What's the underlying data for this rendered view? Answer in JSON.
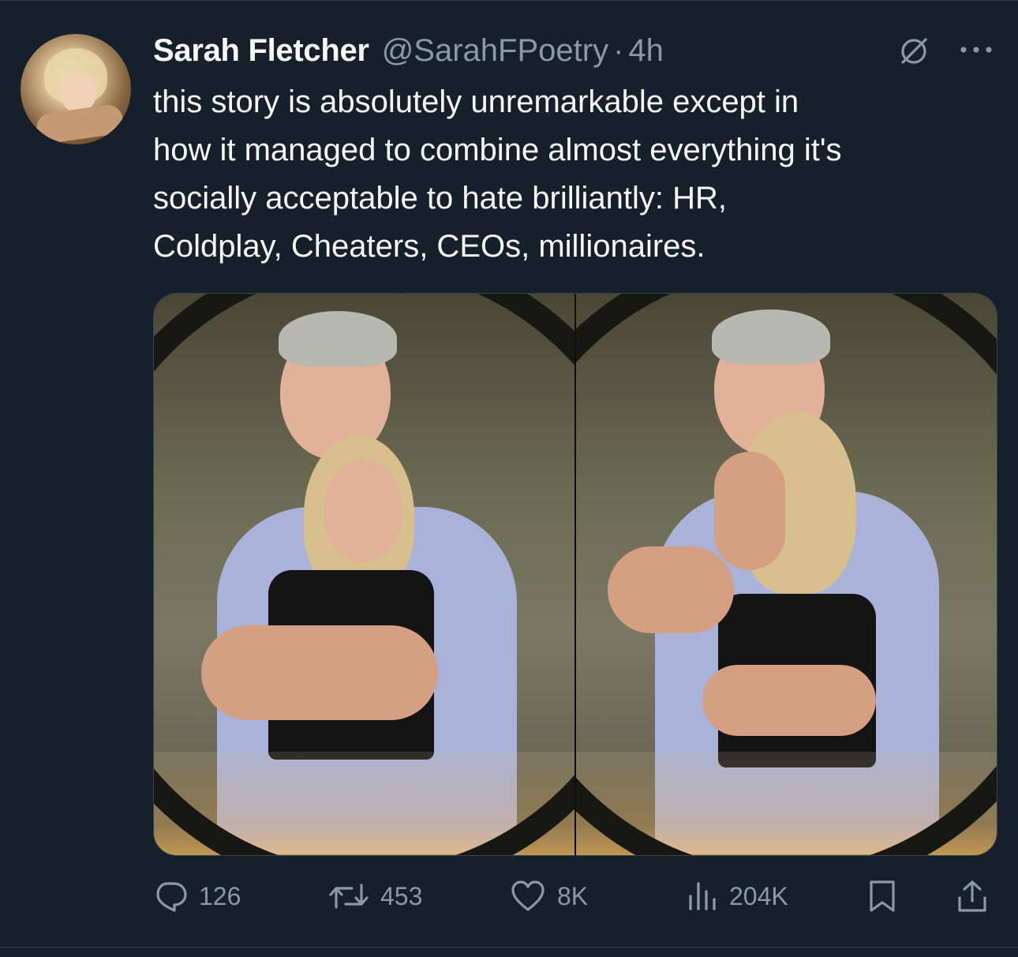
{
  "author": {
    "display_name": "Sarah Fletcher",
    "handle": "@SarahFPoetry",
    "separator": "·",
    "time": "4h"
  },
  "icons": {
    "grok": "grok-icon",
    "more": "more-icon",
    "reply": "reply-icon",
    "retweet": "retweet-icon",
    "like": "heart-icon",
    "views": "views-icon",
    "bookmark": "bookmark-icon",
    "share": "share-icon"
  },
  "tweet": {
    "lines": [
      "this story is absolutely unremarkable except in",
      "how it managed to combine almost everything it's",
      "socially acceptable to hate brilliantly: HR,",
      "Coldplay, Cheaters, CEOs, millionaires."
    ]
  },
  "media": {
    "count": 2
  },
  "metrics": {
    "replies": "126",
    "retweets": "453",
    "likes": "8K",
    "views": "204K"
  },
  "colors": {
    "background": "#15202b",
    "text": "#f7f9f9",
    "secondary": "#8b98a5",
    "border": "#38444d"
  }
}
